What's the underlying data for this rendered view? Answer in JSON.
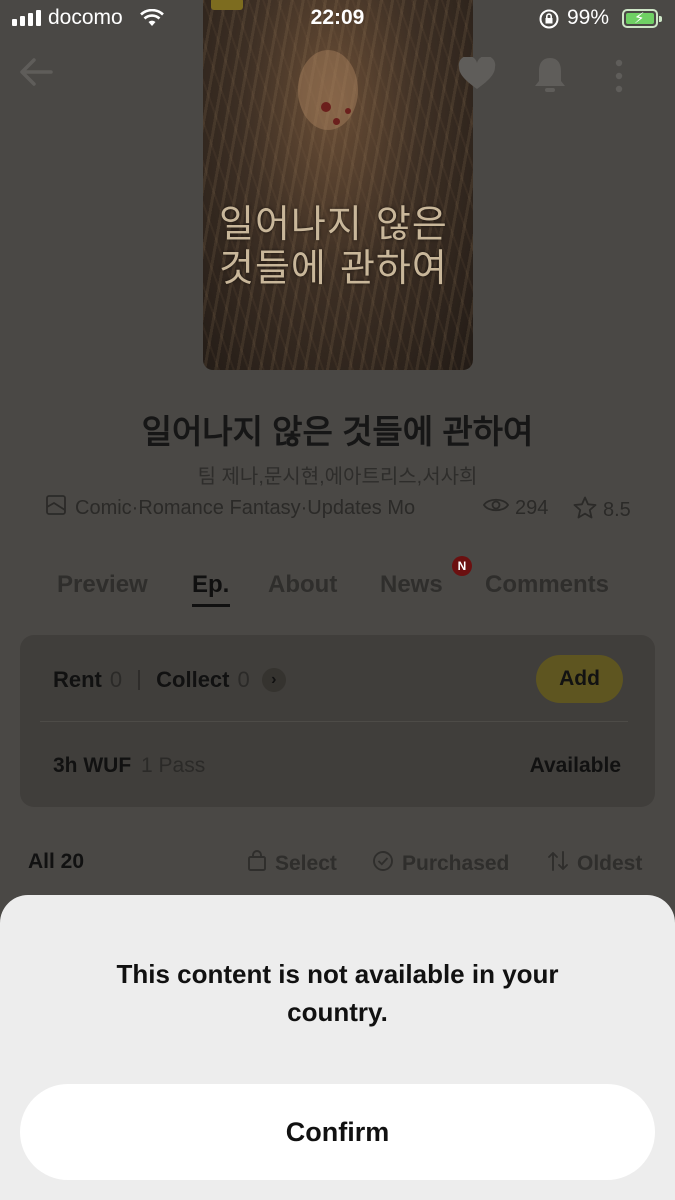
{
  "status_bar": {
    "carrier": "docomo",
    "time": "22:09",
    "battery": "99%"
  },
  "cover": {
    "title_art": "일어나지 않은것들에 관하여"
  },
  "work": {
    "title": "일어나지 않은 것들에 관하여",
    "authors": "팀 제나,문시현,에아트리스,서사희",
    "genre": "Comic·Romance Fantasy·Updates Mo",
    "views": "294",
    "rating": "8.5"
  },
  "tabs": [
    {
      "label": "Preview"
    },
    {
      "label": "Ep."
    },
    {
      "label": "About"
    },
    {
      "label": "News"
    },
    {
      "label": "Comments"
    }
  ],
  "news_badge": "N",
  "pass_card": {
    "rent_label": "Rent",
    "rent_count": "0",
    "collect_label": "Collect",
    "collect_count": "0",
    "add_label": "Add",
    "wuf_label": "3h WUF",
    "wuf_pass": "1 Pass",
    "wuf_status": "Available"
  },
  "list_header": {
    "all_label": "All 20",
    "select_label": "Select",
    "purchased_label": "Purchased",
    "sort_label": "Oldest"
  },
  "dialog": {
    "message": "This content is not available in your country.",
    "confirm_label": "Confirm"
  },
  "colors": {
    "dim_overlay": "#4a4845",
    "sheet_background": "#ededed",
    "add_button": "#5e5520",
    "news_badge": "#6b1010"
  },
  "icons": [
    "back-arrow-icon",
    "heart-icon",
    "bell-icon",
    "more-vertical-icon",
    "book-icon",
    "eye-icon",
    "star-icon",
    "bag-icon",
    "check-circle-icon",
    "sort-icon",
    "chevron-right-icon"
  ]
}
